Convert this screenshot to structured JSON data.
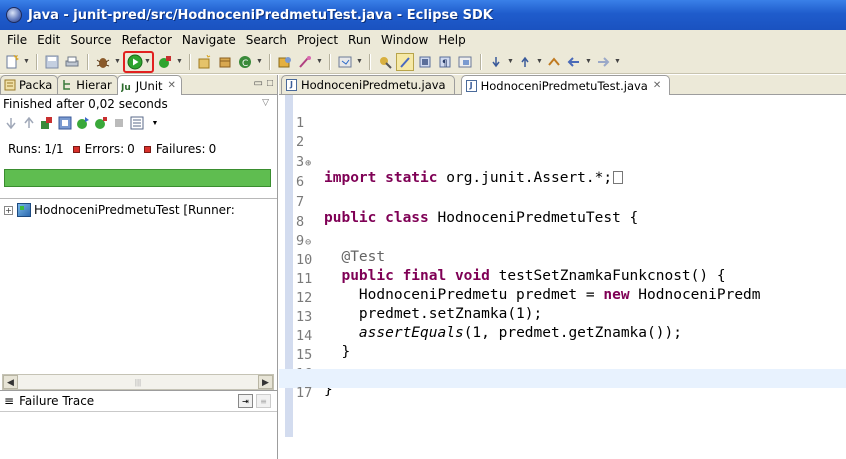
{
  "window": {
    "title": "Java - junit-pred/src/HodnoceniPredmetuTest.java - Eclipse SDK"
  },
  "menu": [
    "File",
    "Edit",
    "Source",
    "Refactor",
    "Navigate",
    "Search",
    "Project",
    "Run",
    "Window",
    "Help"
  ],
  "left_panel": {
    "tabs": [
      {
        "label": "Packa",
        "icon": "package-explorer-icon"
      },
      {
        "label": "Hierar",
        "icon": "hierarchy-icon"
      },
      {
        "label": "JUnit",
        "icon": "junit-icon",
        "active": true
      }
    ],
    "status": "Finished after 0,02 seconds",
    "runs_label": "Runs:",
    "runs_value": "1/1",
    "errors_label": "Errors:",
    "errors_value": "0",
    "failures_label": "Failures:",
    "failures_value": "0",
    "progress_color": "#5fbd50",
    "tree_item": "HodnoceniPredmetuTest [Runner:",
    "failure_trace": "Failure Trace"
  },
  "editor": {
    "tabs": [
      {
        "label": "HodnoceniPredmetu.java",
        "active": false
      },
      {
        "label": "HodnoceniPredmetuTest.java",
        "active": true
      }
    ],
    "lines": [
      {
        "n": "1",
        "fold": ""
      },
      {
        "n": "2",
        "fold": ""
      },
      {
        "n": "3",
        "fold": "⊕"
      },
      {
        "n": "6",
        "fold": ""
      },
      {
        "n": "7",
        "fold": ""
      },
      {
        "n": "8",
        "fold": ""
      },
      {
        "n": "9",
        "fold": "⊖"
      },
      {
        "n": "10",
        "fold": ""
      },
      {
        "n": "11",
        "fold": ""
      },
      {
        "n": "12",
        "fold": ""
      },
      {
        "n": "13",
        "fold": ""
      },
      {
        "n": "14",
        "fold": ""
      },
      {
        "n": "15",
        "fold": ""
      },
      {
        "n": "16",
        "fold": ""
      },
      {
        "n": "17",
        "fold": ""
      }
    ],
    "code": {
      "l3_kw": "import static",
      "l3_rest": " org.junit.Assert.*;",
      "l7_kw": "public class",
      "l7_rest": " HodnoceniPredmetuTest {",
      "l9": "  @Test",
      "l10_kw": "  public final void",
      "l10_rest": " testSetZnamkaFunkcnost() {",
      "l11_a": "    HodnoceniPredmetu predmet = ",
      "l11_kw": "new",
      "l11_b": " HodnoceniPredm",
      "l12": "    predmet.setZnamka(1);",
      "l13_it": "    assertEquals",
      "l13_rest": "(1, predmet.getZnamka());",
      "l14": "  }",
      "l16": "}"
    }
  }
}
